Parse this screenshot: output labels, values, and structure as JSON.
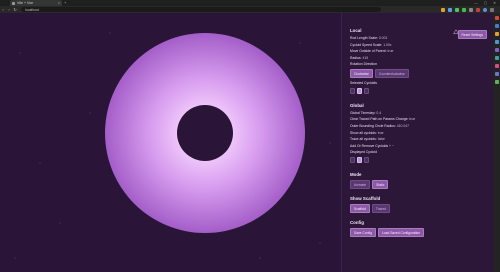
{
  "browser": {
    "tab_title": "Vite + Vue",
    "tab_close": "×",
    "new_tab": "+",
    "url": "localhost",
    "win_controls": [
      "—",
      "▢",
      "✕"
    ],
    "nav": [
      "‹",
      "›",
      "↻"
    ]
  },
  "local": {
    "title": "Local",
    "rows": [
      {
        "label": "Rod Length Scale:",
        "value": "0.001"
      },
      {
        "label": "Cycloid Speed Scale:",
        "value": "1.00x"
      },
      {
        "label": "Move Outside of Parent:",
        "value": "true"
      },
      {
        "label": "Radius:",
        "value": "415"
      },
      {
        "label": "Rotation Direction",
        "value": ""
      }
    ],
    "direction_buttons": [
      "Clockwise",
      "Counterclockwise"
    ],
    "selected_label": "Selected Cycloids",
    "swatches": [
      false,
      true,
      false
    ]
  },
  "reset_button": "Reset Settings",
  "global": {
    "title": "Global",
    "rows": [
      {
        "label": "Global Timestep:",
        "value": "0.4"
      },
      {
        "label": "Clear Traced Path on Params Change:",
        "value": "true"
      },
      {
        "label": "Outer Bounding Circle Radius:",
        "value": "410.047"
      },
      {
        "label": "Show all cycloids:",
        "value": "true"
      },
      {
        "label": "Trace all cycloids:",
        "value": "false"
      },
      {
        "label": "Add Or Remove Cycloids",
        "value": "+  −"
      },
      {
        "label": "Displayed Cycloid",
        "value": ""
      }
    ],
    "swatches": [
      false,
      true,
      false
    ]
  },
  "mode": {
    "title": "Mode",
    "buttons": [
      "Animate",
      "Static"
    ]
  },
  "scaffold": {
    "title": "Show Scaffold",
    "buttons": [
      "Scaffold",
      "Traced"
    ]
  },
  "config": {
    "title": "Config",
    "buttons": [
      "Save Config",
      "Load Saved Configuration"
    ]
  },
  "colors": {
    "background": "#2a1538",
    "ring_inner": "#e6b4f8",
    "ring_outer": "#a35ec8"
  }
}
